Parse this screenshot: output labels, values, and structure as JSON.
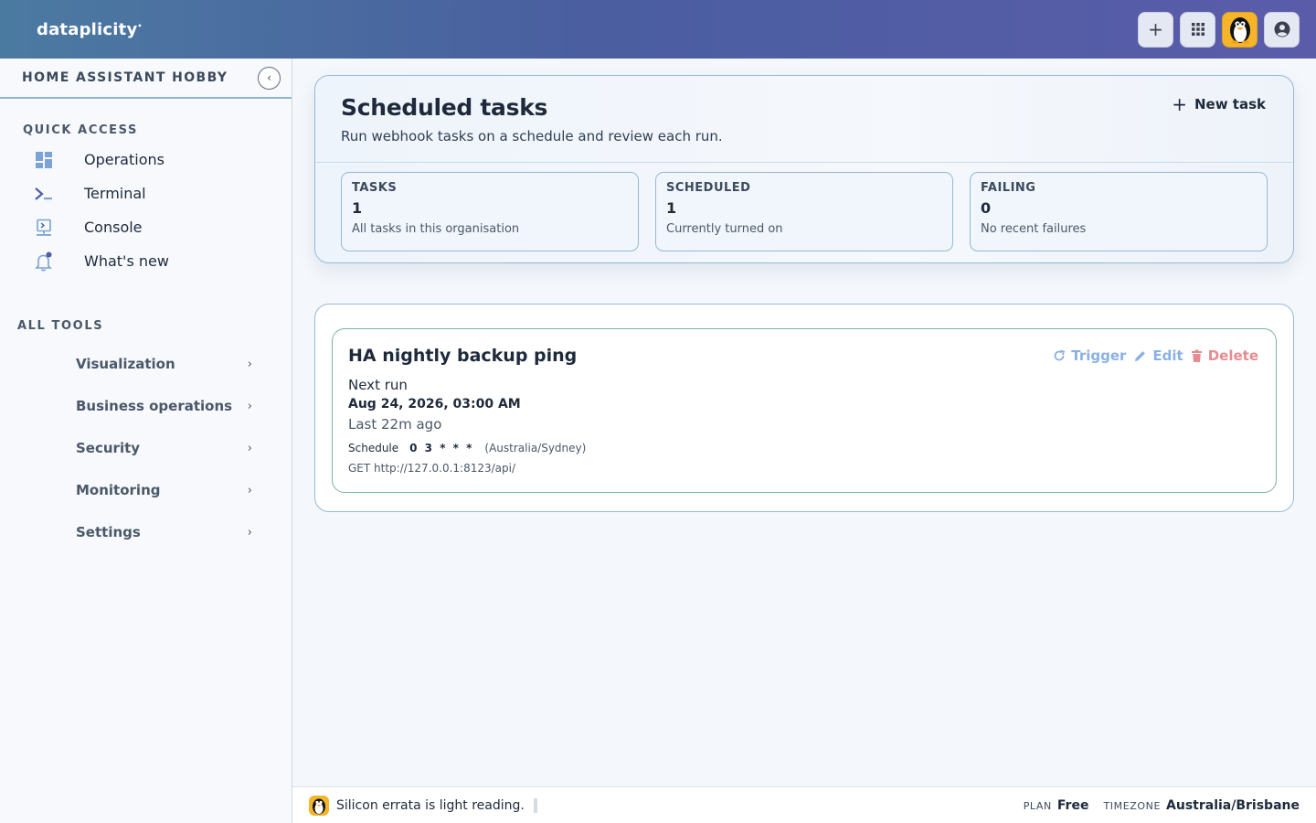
{
  "brand": {
    "name": "dataplicity",
    "mark": "•"
  },
  "topbar": {
    "add_icon": "plus-icon",
    "apps_icon": "grid-icon",
    "avatar_icon": "penguin-icon",
    "account_icon": "user-circle-icon"
  },
  "sidebar": {
    "org_name": "HOME ASSISTANT HOBBY",
    "quick_access_label": "QUICK ACCESS",
    "quick_access": [
      {
        "label": "Operations",
        "icon": "dashboard-icon"
      },
      {
        "label": "Terminal",
        "icon": "terminal-icon"
      },
      {
        "label": "Console",
        "icon": "console-icon"
      },
      {
        "label": "What's new",
        "icon": "bell-icon"
      }
    ],
    "all_tools_label": "ALL TOOLS",
    "tools": [
      {
        "label": "Visualization"
      },
      {
        "label": "Business operations"
      },
      {
        "label": "Security"
      },
      {
        "label": "Monitoring"
      },
      {
        "label": "Settings"
      }
    ]
  },
  "hero": {
    "title": "Scheduled tasks",
    "subtitle": "Run webhook tasks on a schedule and review each run.",
    "new_task_label": "New task",
    "stats": [
      {
        "key": "TASKS",
        "value": "1",
        "desc": "All tasks in this organisation"
      },
      {
        "key": "SCHEDULED",
        "value": "1",
        "desc": "Currently turned on"
      },
      {
        "key": "FAILING",
        "value": "0",
        "desc": "No recent failures"
      }
    ]
  },
  "task": {
    "name": "HA nightly backup ping",
    "trigger_label": "Trigger",
    "edit_label": "Edit",
    "delete_label": "Delete",
    "next_run_label": "Next run",
    "next_run_value": "Aug 24, 2026, 03:00 AM",
    "last_run": "Last 22m ago",
    "schedule_label": "Schedule",
    "cron": "0 3 * * *",
    "timezone": "(Australia/Sydney)",
    "endpoint": "GET http://127.0.0.1:8123/api/"
  },
  "footer": {
    "ticker": "Silicon errata is light reading.",
    "plan_label": "PLAN",
    "plan_value": "Free",
    "timezone_label": "TIMEZONE",
    "timezone_value": "Australia/Brisbane"
  },
  "colors": {
    "accent": "#4a5ea0",
    "trigger": "#8ab1e3",
    "delete": "#e58c91",
    "card_border": "#7bb39f"
  }
}
